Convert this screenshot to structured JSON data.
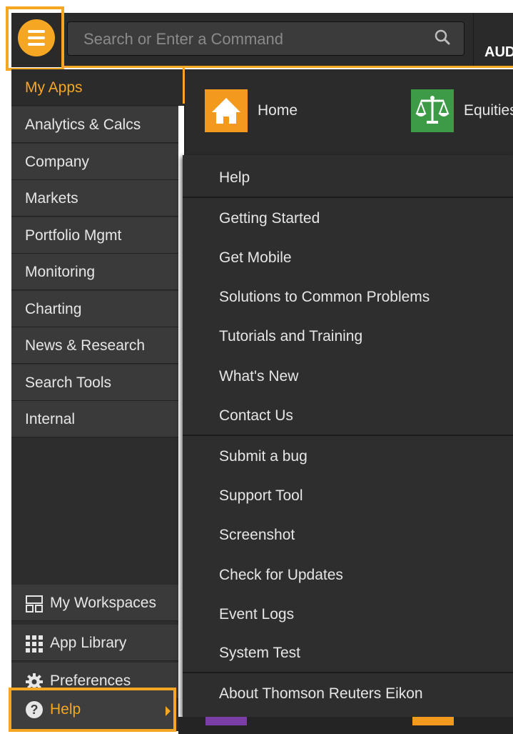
{
  "search": {
    "placeholder": "Search or Enter a Command"
  },
  "header": {
    "ticker_label": "AUD"
  },
  "sidebar": {
    "items": [
      {
        "label": "My Apps",
        "active": true
      },
      {
        "label": "Analytics & Calcs"
      },
      {
        "label": "Company"
      },
      {
        "label": "Markets"
      },
      {
        "label": "Portfolio Mgmt"
      },
      {
        "label": "Monitoring"
      },
      {
        "label": "Charting"
      },
      {
        "label": "News & Research"
      },
      {
        "label": "Search Tools"
      },
      {
        "label": "Internal"
      }
    ],
    "bottom": {
      "workspaces": "My Workspaces",
      "app_library": "App Library",
      "preferences": "Preferences",
      "help": "Help"
    }
  },
  "tiles": {
    "home": "Home",
    "equities": "Equities"
  },
  "help_menu": {
    "group1": [
      "Help",
      "Getting Started",
      "Get Mobile",
      "Solutions to Common Problems",
      "Tutorials and Training",
      "What's New",
      "Contact Us"
    ],
    "group2": [
      "Submit a bug",
      "Support Tool",
      "Screenshot",
      "Check for Updates",
      "Event Logs",
      "System Test"
    ],
    "group3": [
      "About Thomson Reuters Eikon"
    ]
  },
  "colors": {
    "accent": "#f5a623",
    "panel": "#2e2e2e",
    "sidebar": "#3a3a3a",
    "home_tile": "#f39a1e",
    "equities_tile": "#3d9a46"
  }
}
